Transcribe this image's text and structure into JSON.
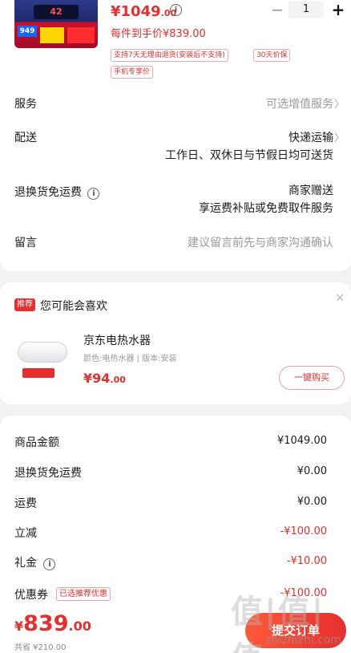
{
  "product": {
    "thumb_screen": "42",
    "thumb_badge": "949",
    "price_prefix": "¥",
    "price_int": "1049",
    "price_dec": ".00",
    "quantity": "1",
    "hand_price": "每件到手价¥839.00",
    "tags": [
      "支持7天无理由退货(安装后不支持)",
      "30天价保",
      "手机专享价"
    ]
  },
  "rows": [
    {
      "label": "服务",
      "value": "可选增值服务",
      "muted": true,
      "chevron": true
    },
    {
      "label": "配送",
      "value": "快递运输",
      "sub": "工作日、双休日与节假日均可送货",
      "chevron": true
    },
    {
      "label": "退换货免运费",
      "info": true,
      "value": "商家赠送",
      "sub": "享运费补贴或免费取件服务"
    },
    {
      "label": "留言",
      "value": "建议留言前先与商家沟通确认",
      "muted": true
    }
  ],
  "recommend": {
    "badge": "推荐",
    "title": "您可能会喜欢",
    "item_name": "京东电热水器",
    "item_spec": "颜色:电热水器 | 版本:安装",
    "price_prefix": "¥",
    "price_int": "94",
    "price_dec": ".00",
    "buy_label": "一键购买"
  },
  "summary": [
    {
      "label": "商品金额",
      "value": "¥1049.00"
    },
    {
      "label": "退换货免运费",
      "value": "¥0.00"
    },
    {
      "label": "运费",
      "value": "¥0.00"
    },
    {
      "label": "立减",
      "value": "-¥100.00",
      "red": true
    },
    {
      "label": "礼金",
      "value": "-¥10.00",
      "red": true,
      "info": true
    },
    {
      "label": "优惠券",
      "value": "-¥100.00",
      "red": true,
      "tag": "已选推荐优惠"
    }
  ],
  "bottom": {
    "total_prefix": "¥",
    "total_int": "839",
    "total_dec": ".00",
    "saved": "共省 ¥210.00",
    "submit_label": "提交订单"
  },
  "watermark": {
    "zh": "值|值|值",
    "en": "zhizhizhi.com"
  },
  "colors": {
    "accent": "#e62e2e",
    "background": "#f2f2f2"
  }
}
